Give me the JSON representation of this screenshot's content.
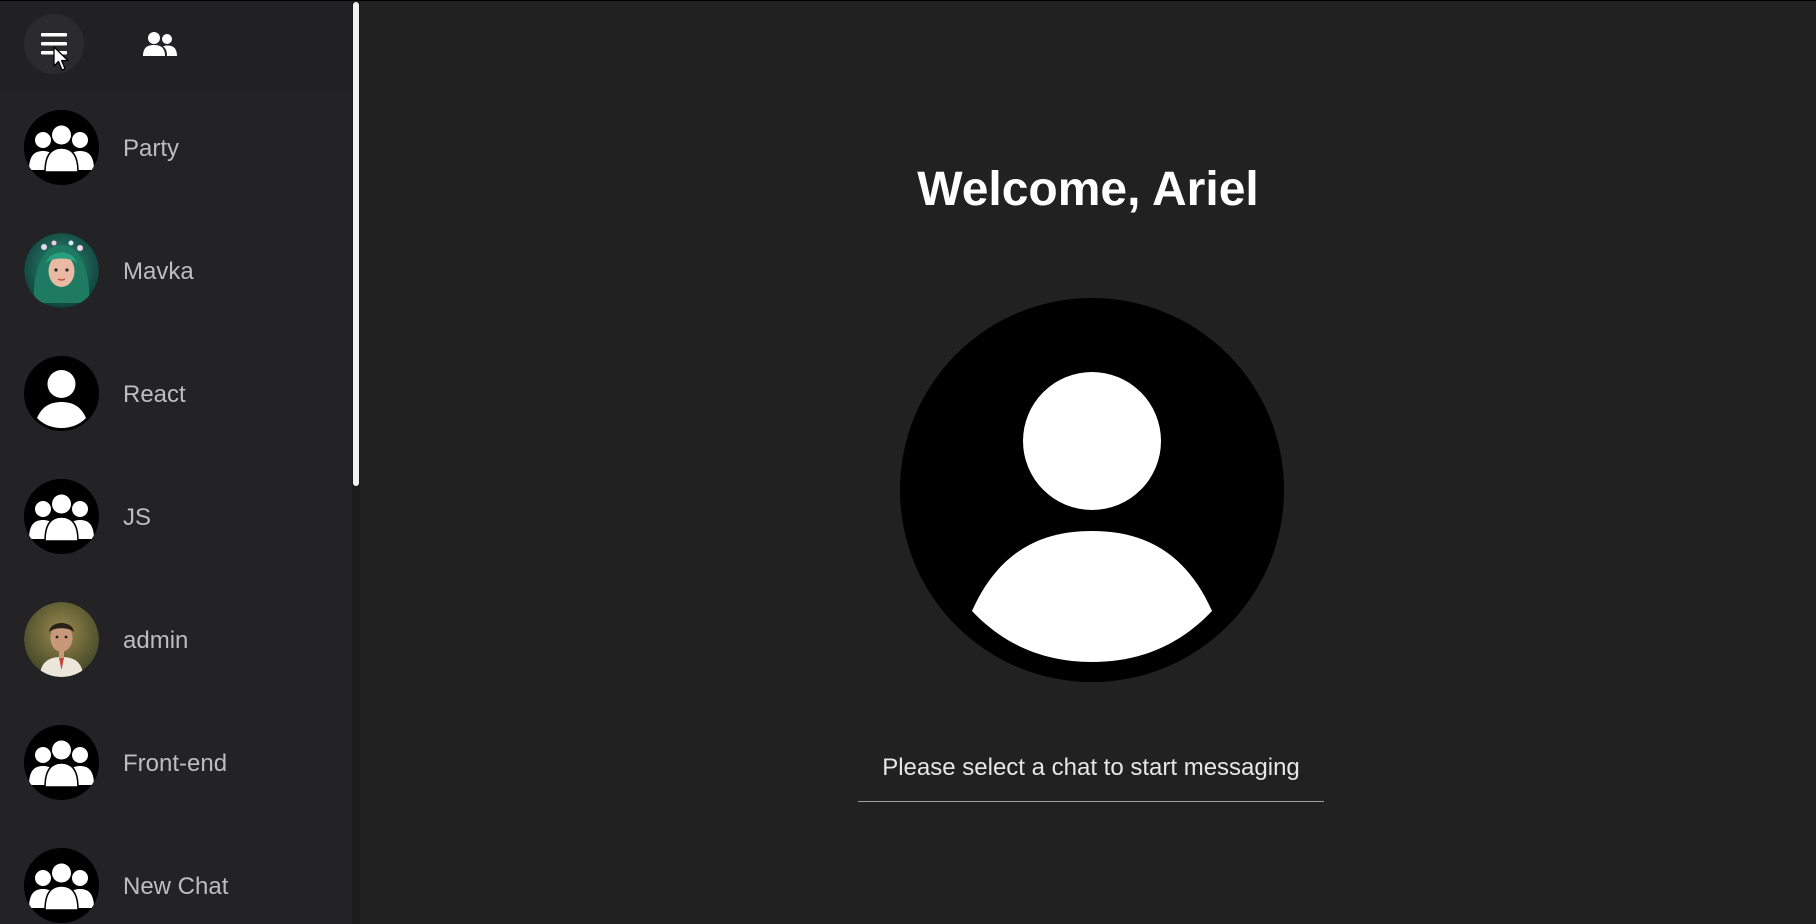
{
  "sidebar": {
    "header": {
      "menu_icon": "hamburger-menu-icon",
      "contacts_icon": "users-icon"
    },
    "chats": [
      {
        "name": "Party",
        "avatar": "group"
      },
      {
        "name": "Mavka",
        "avatar": "photo-mavka"
      },
      {
        "name": "React",
        "avatar": "person"
      },
      {
        "name": "JS",
        "avatar": "group"
      },
      {
        "name": "admin",
        "avatar": "photo-admin"
      },
      {
        "name": "Front-end",
        "avatar": "group"
      },
      {
        "name": "New Chat",
        "avatar": "group"
      }
    ]
  },
  "main": {
    "welcome_title": "Welcome, Ariel",
    "avatar_icon": "default-user-avatar-icon",
    "prompt": "Please select a chat to start messaging"
  },
  "colors": {
    "background": "#212121",
    "sidebar": "#232325",
    "text_primary": "#ffffff",
    "text_secondary": "#bdbdbd"
  }
}
